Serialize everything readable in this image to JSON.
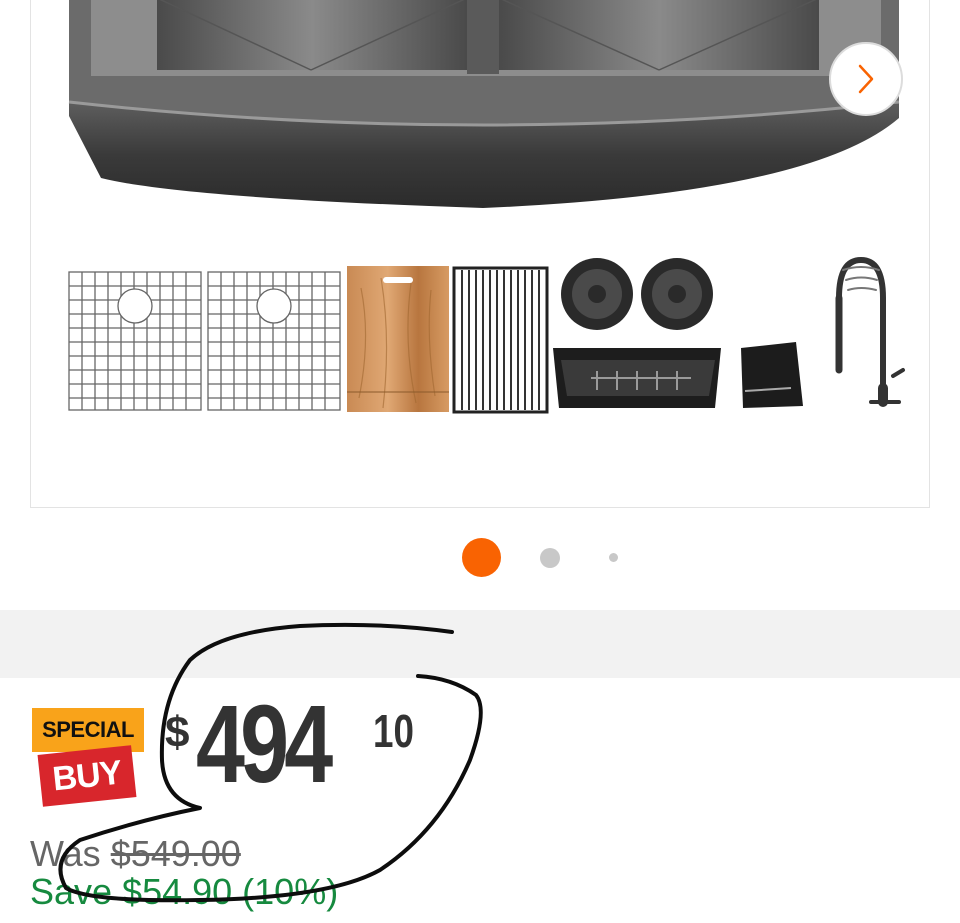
{
  "gallery": {
    "next_label": "›",
    "page_count": 3,
    "active_page": 1,
    "accessory_items": [
      "sink-grid-left",
      "sink-grid-right",
      "cutting-board",
      "roll-up-drying-rack",
      "strainers",
      "colander",
      "towel",
      "faucet"
    ]
  },
  "badge": {
    "line1": "SPECIAL",
    "line2": "BUY"
  },
  "price": {
    "currency": "$",
    "dollars": "494",
    "cents": "10"
  },
  "was": {
    "label": "Was",
    "amount": "$549.00"
  },
  "savings": {
    "text": "Save $54.90 (10%)"
  },
  "colors": {
    "accent": "#f96302",
    "special_badge": "#f9a31a",
    "buy_badge": "#d8262c",
    "save_text": "#168a3f"
  }
}
